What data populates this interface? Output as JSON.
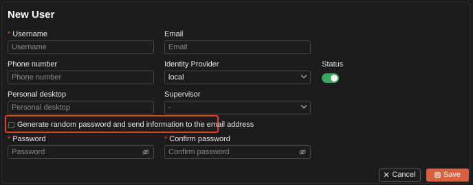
{
  "dialog": {
    "title": "New User"
  },
  "form": {
    "username": {
      "label": "Username",
      "placeholder": "Username",
      "required": true
    },
    "email": {
      "label": "Email",
      "placeholder": "Email"
    },
    "phone": {
      "label": "Phone number",
      "placeholder": "Phone number"
    },
    "identity_provider": {
      "label": "Identity Provider",
      "value": "local"
    },
    "status": {
      "label": "Status",
      "enabled": true
    },
    "personal_desktop": {
      "label": "Personal desktop",
      "placeholder": "Personal desktop"
    },
    "supervisor": {
      "label": "Supervisor",
      "value": "-"
    },
    "generate_password": {
      "label": "Generate random password and send information to the email address",
      "checked": false
    },
    "password": {
      "label": "Password",
      "placeholder": "Password",
      "required": true
    },
    "confirm_password": {
      "label": "Confirm password",
      "placeholder": "Confirm password",
      "required": true
    }
  },
  "footer": {
    "cancel_label": "Cancel",
    "save_label": "Save"
  },
  "colors": {
    "background": "#1c1c1e",
    "accent": "#d9603f",
    "required": "#e2553b",
    "toggle_on": "#3aa55d",
    "highlight": "#d9452e"
  },
  "icons": {
    "cancel": "close-icon",
    "save": "save-icon",
    "password_visibility": "eye-off-icon",
    "dropdown": "chevron-down-icon"
  }
}
